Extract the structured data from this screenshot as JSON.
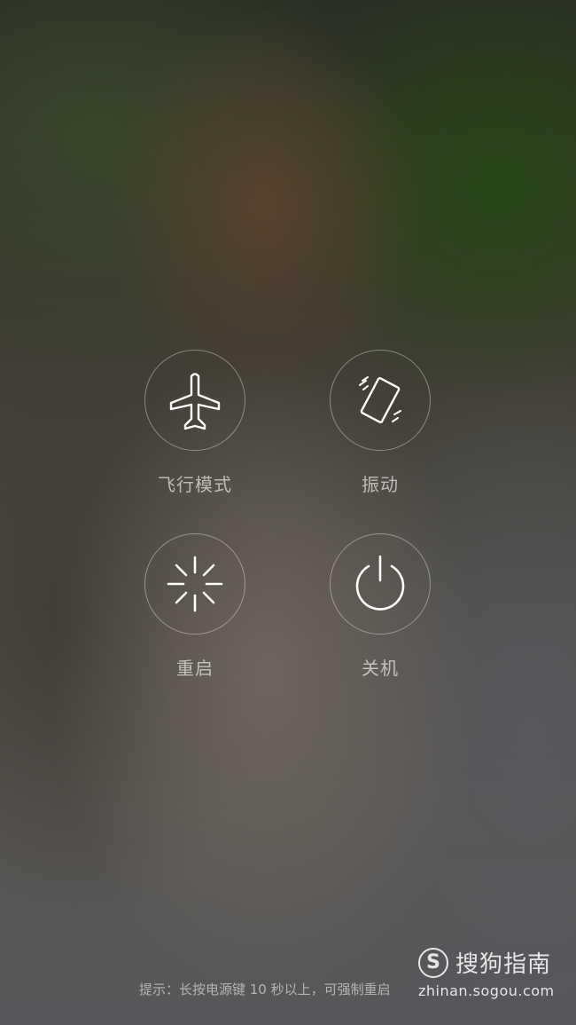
{
  "power_menu": {
    "airplane_mode": {
      "label": "飞行模式",
      "icon": "airplane-icon"
    },
    "vibrate": {
      "label": "振动",
      "icon": "vibrate-phone-icon"
    },
    "reboot": {
      "label": "重启",
      "icon": "reboot-spinner-icon"
    },
    "power_off": {
      "label": "关机",
      "icon": "power-icon"
    }
  },
  "hint": {
    "text": "提示：长按电源键 10 秒以上，可强制重启"
  },
  "watermark": {
    "logo_letter": "S",
    "name": "搜狗指南",
    "url": "zhinan.sogou.com"
  }
}
